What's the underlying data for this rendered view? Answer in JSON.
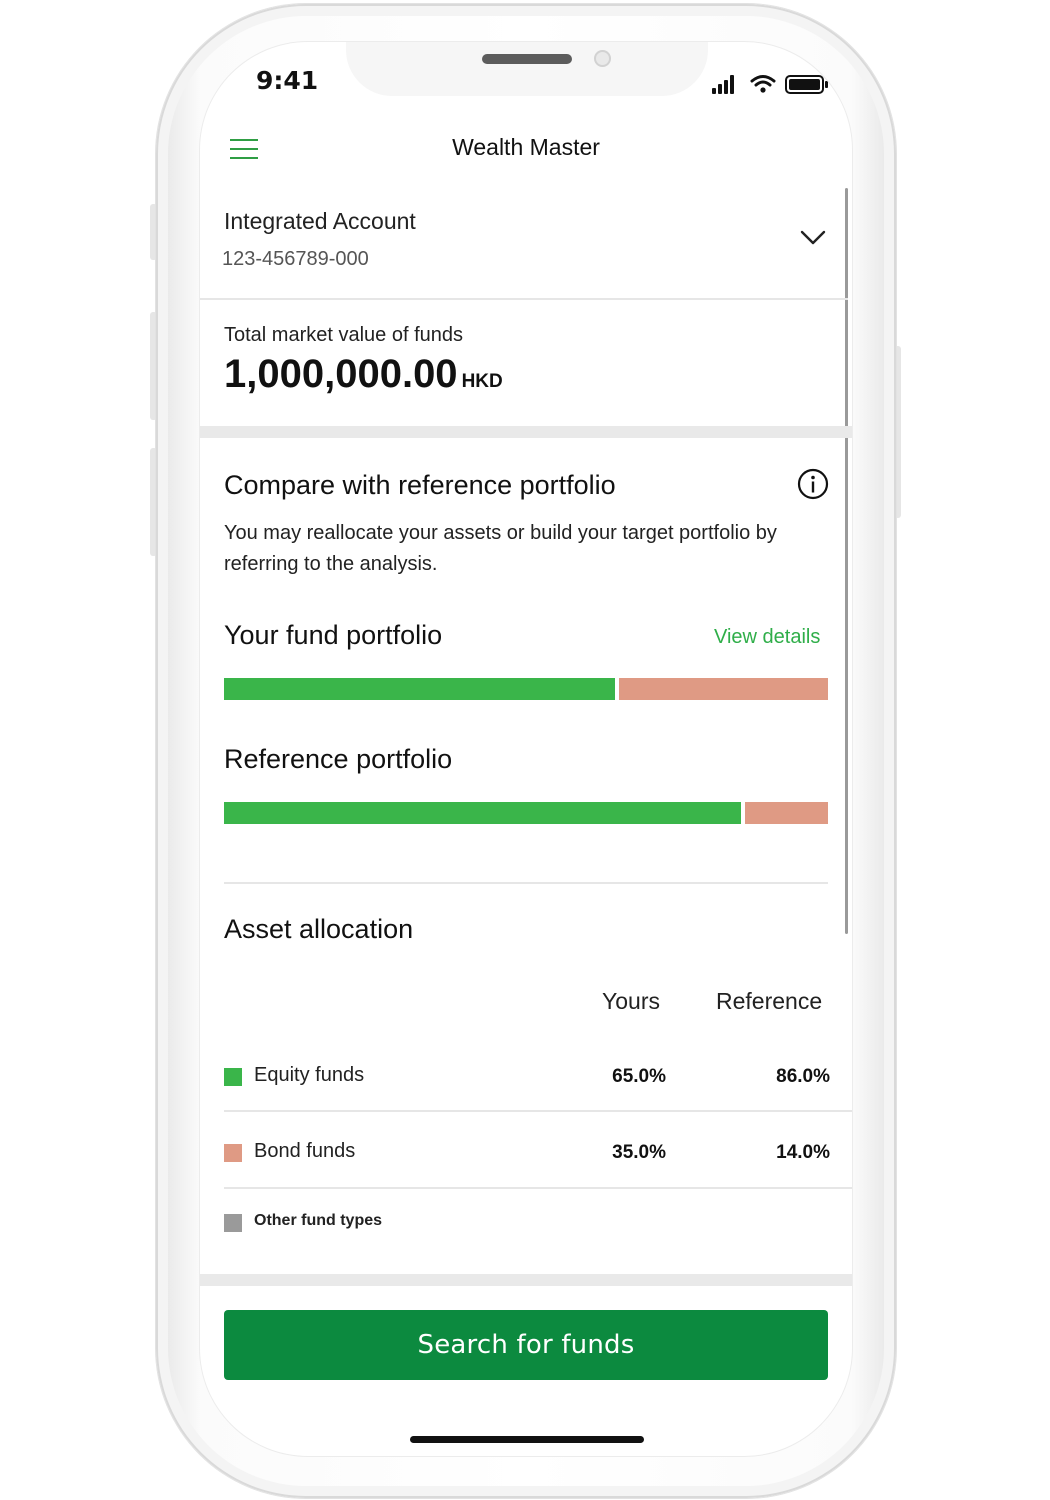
{
  "status_bar": {
    "time": "9:41"
  },
  "header": {
    "title": "Wealth Master"
  },
  "account": {
    "name": "Integrated Account",
    "number": "123-456789-000"
  },
  "market": {
    "label": "Total market value of funds",
    "value": "1,000,000.00",
    "currency": "HKD"
  },
  "compare": {
    "title": "Compare with reference portfolio",
    "description": "You may reallocate your assets or build your target portfolio by referring to the analysis.",
    "your_portfolio_label": "Your fund portfolio",
    "view_details": "View details",
    "reference_label": "Reference portfolio",
    "your_split": {
      "equity_pct": 65.0,
      "bond_pct": 35.0
    },
    "reference_split": {
      "equity_pct": 86.0,
      "bond_pct": 14.0
    }
  },
  "allocation": {
    "title": "Asset allocation",
    "col_yours": "Yours",
    "col_reference": "Reference",
    "rows": [
      {
        "label": "Equity funds",
        "yours": "65.0%",
        "reference": "86.0%"
      },
      {
        "label": "Bond funds",
        "yours": "35.0%",
        "reference": "14.0%"
      },
      {
        "label": "Other fund types",
        "yours": "",
        "reference": ""
      }
    ]
  },
  "colors": {
    "equity": "#3ab54a",
    "bond": "#df9a84",
    "other": "#9a9a9a",
    "accent": "#0c8a3f"
  },
  "actions": {
    "search_button": "Search for funds"
  }
}
